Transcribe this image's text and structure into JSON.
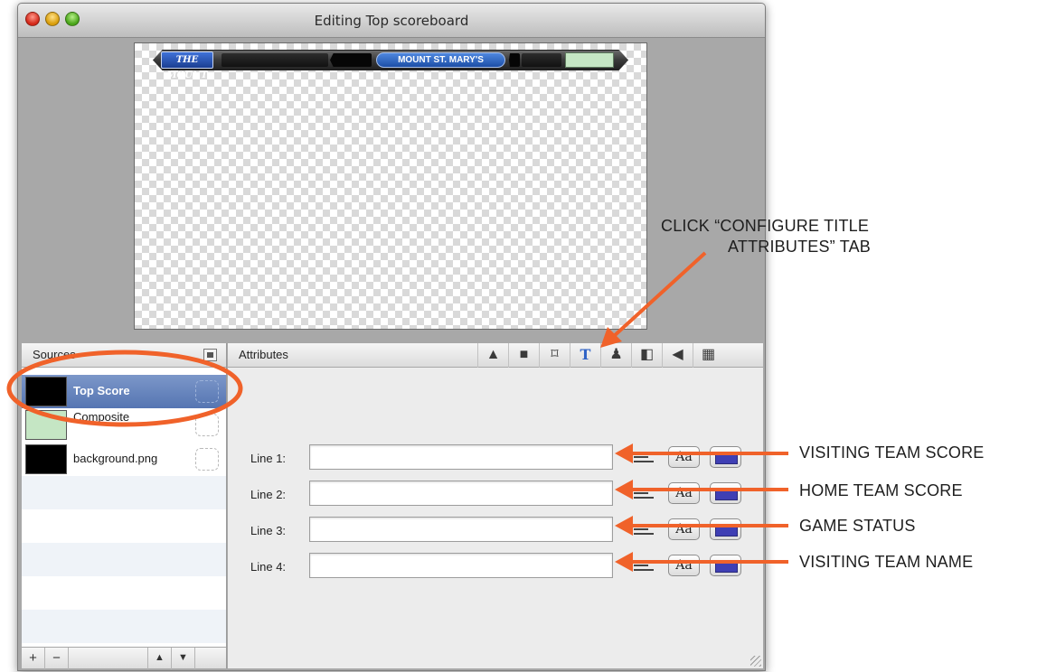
{
  "window": {
    "title": "Editing Top scoreboard"
  },
  "preview": {
    "logo_text": "THE MOUNT",
    "team_name": "MOUNT ST. MARY'S",
    "accent_green": "#c5e6c4"
  },
  "sources": {
    "header": "Sources",
    "items": [
      {
        "label": "Top Score",
        "selected": true
      },
      {
        "label": "Composite",
        "selected": false
      },
      {
        "label": "background.png",
        "selected": false
      }
    ],
    "footer": {
      "add": "+",
      "remove": "−",
      "up": "▲",
      "down": "▼"
    }
  },
  "attributes": {
    "header": "Attributes",
    "tabs": [
      {
        "icon": "shapes-icon",
        "glyph": "▲"
      },
      {
        "icon": "folder-icon",
        "glyph": "■"
      },
      {
        "icon": "crop-icon",
        "glyph": "⌑"
      },
      {
        "icon": "text-icon",
        "glyph": "T",
        "active": true
      },
      {
        "icon": "person-icon",
        "glyph": "♟"
      },
      {
        "icon": "mask-icon",
        "glyph": "◧"
      },
      {
        "icon": "speaker-icon",
        "glyph": "◀"
      },
      {
        "icon": "film-icon",
        "glyph": "▦"
      }
    ],
    "lines": [
      {
        "label": "Line 1:",
        "value": "",
        "font_label": "Aa"
      },
      {
        "label": "Line 2:",
        "value": "",
        "font_label": "Aa"
      },
      {
        "label": "Line 3:",
        "value": "",
        "font_label": "Aa"
      },
      {
        "label": "Line 4:",
        "value": "",
        "font_label": "Aa"
      }
    ]
  },
  "annotations": {
    "tab_callout_line1": "CLICK “CONFIGURE TITLE",
    "tab_callout_line2": "ATTRIBUTES” TAB",
    "line_callouts": [
      "VISITING TEAM SCORE",
      "HOME TEAM SCORE",
      "GAME STATUS",
      "VISITING TEAM NAME"
    ],
    "color": "#f0622a"
  }
}
